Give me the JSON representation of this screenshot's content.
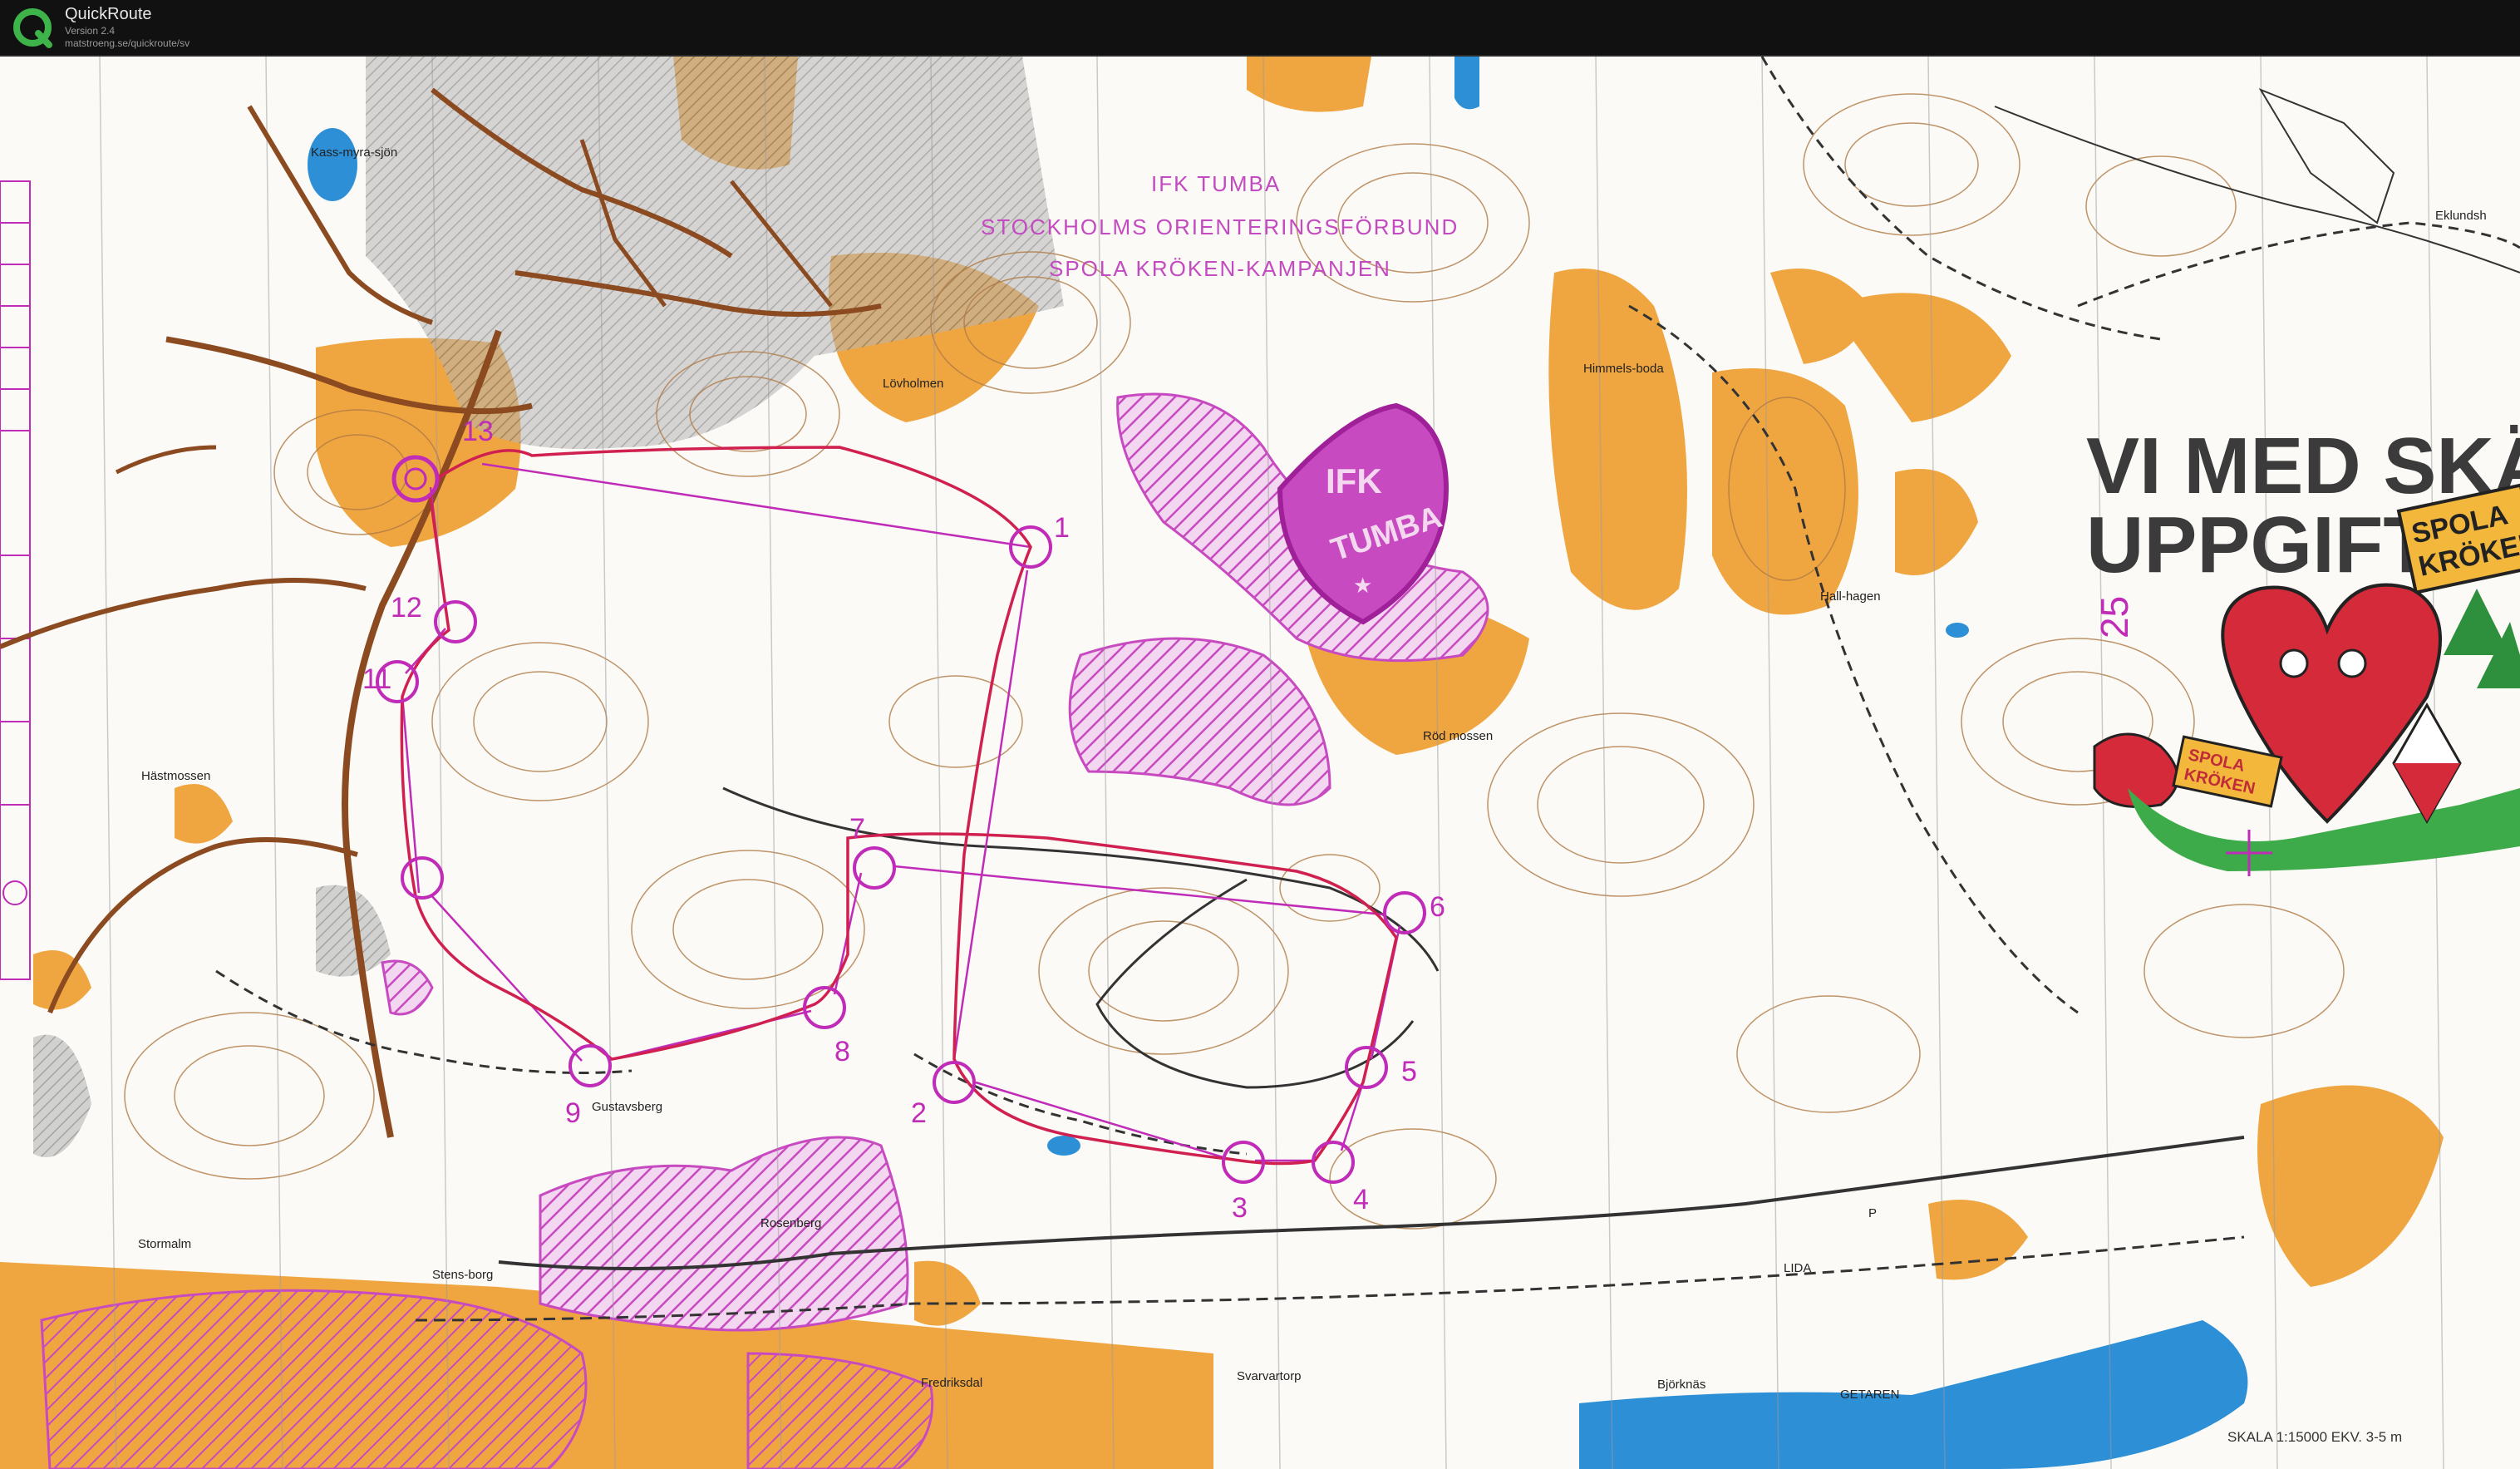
{
  "app": {
    "title": "QuickRoute",
    "version": "Version 2.4",
    "url": "matstroeng.se/quickroute/sv",
    "icon": "q-logo-icon"
  },
  "colors": {
    "terrain_open": "#f0a640",
    "water": "#2d8fd6",
    "course": "#c02bb8",
    "route": "#d02050",
    "contour": "#b07a45",
    "paper": "#fbfaf6"
  },
  "map_heading": {
    "club": "IFK TUMBA",
    "federation": "STOCKHOLMS ORIENTERINGSFÖRBUND",
    "campaign": "SPOLA KRÖKEN-KAMPANJEN"
  },
  "emblem": {
    "line1": "IFK",
    "line2": "TUMBA"
  },
  "advert": {
    "line1": "VI MED SKÄRPT",
    "line2": "UPPGIFTER",
    "badge_line1": "SPOLA",
    "badge_line2": "KRÖKEN",
    "number": "25",
    "sign_line1": "SPOLA",
    "sign_line2": "KRÖKEN"
  },
  "place_names": [
    "Kass-myra-sjön",
    "Lövholmen",
    "Himmels-boda",
    "Eklundsh",
    "Hästmossen",
    "Röd mossen",
    "Hall-hagen",
    "Gustavsberg",
    "Rosenberg",
    "Stormalm",
    "Stens-borg",
    "Fredriksdal",
    "Svarvartorp",
    "Björknäs",
    "LIDA",
    "GETAREN",
    "P"
  ],
  "controls": [
    "1",
    "2",
    "3",
    "4",
    "5",
    "6",
    "7",
    "8",
    "9",
    "11",
    "12",
    "13"
  ],
  "scale": "SKALA 1:15000   EKV. 3-5 m"
}
